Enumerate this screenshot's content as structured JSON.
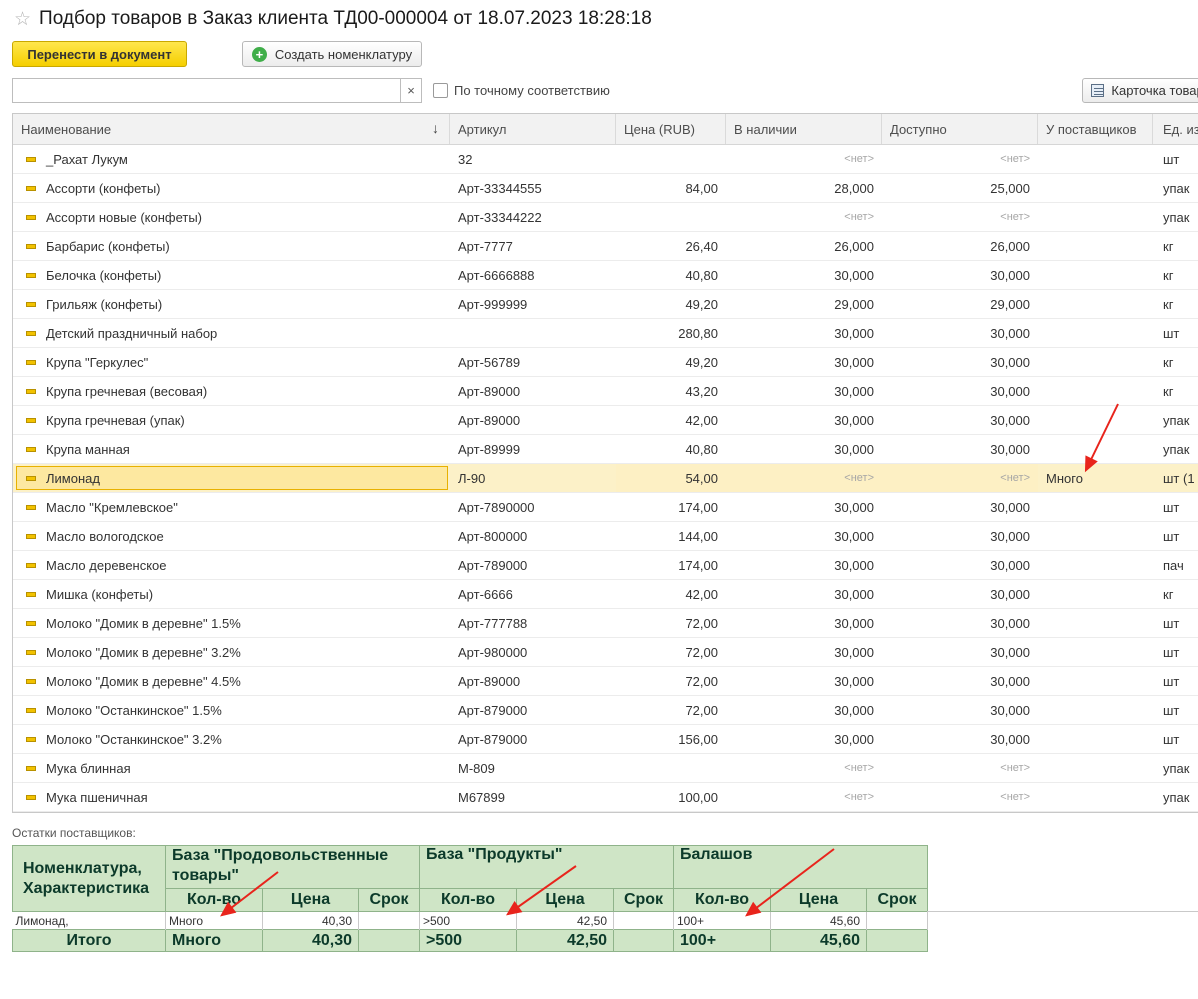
{
  "window": {
    "title": "Подбор товаров в Заказ клиента ТД00-000004 от 18.07.2023 18:28:18"
  },
  "toolbar": {
    "transfer_label": "Перенести в документ",
    "create_label": "Создать номенклатуру",
    "search_value": "",
    "exact_match_label": "По точному соответствию",
    "card_label": "Карточка товара",
    "net_text": "<нет>"
  },
  "grid": {
    "columns": [
      "Наименование",
      "Артикул",
      "Цена (RUB)",
      "В наличии",
      "Доступно",
      "У поставщиков",
      "Ед. изм."
    ],
    "selected_index": 11,
    "rows": [
      {
        "name": "_Рахат Лукум",
        "art": "32",
        "price": "",
        "stock": null,
        "avail": null,
        "supp": "",
        "unit": "шт"
      },
      {
        "name": "Ассорти (конфеты)",
        "art": "Арт-33344555",
        "price": "84,00",
        "stock": "28,000",
        "avail": "25,000",
        "supp": "",
        "unit": "упак"
      },
      {
        "name": "Ассорти новые (конфеты)",
        "art": "Арт-33344222",
        "price": "",
        "stock": null,
        "avail": null,
        "supp": "",
        "unit": "упак"
      },
      {
        "name": "Барбарис (конфеты)",
        "art": "Арт-7777",
        "price": "26,40",
        "stock": "26,000",
        "avail": "26,000",
        "supp": "",
        "unit": "кг"
      },
      {
        "name": "Белочка (конфеты)",
        "art": "Арт-6666888",
        "price": "40,80",
        "stock": "30,000",
        "avail": "30,000",
        "supp": "",
        "unit": "кг"
      },
      {
        "name": "Грильяж (конфеты)",
        "art": "Арт-999999",
        "price": "49,20",
        "stock": "29,000",
        "avail": "29,000",
        "supp": "",
        "unit": "кг"
      },
      {
        "name": "Детский праздничный набор",
        "art": "",
        "price": "280,80",
        "stock": "30,000",
        "avail": "30,000",
        "supp": "",
        "unit": "шт"
      },
      {
        "name": "Крупа \"Геркулес\"",
        "art": "Арт-56789",
        "price": "49,20",
        "stock": "30,000",
        "avail": "30,000",
        "supp": "",
        "unit": "кг"
      },
      {
        "name": "Крупа гречневая (весовая)",
        "art": "Арт-89000",
        "price": "43,20",
        "stock": "30,000",
        "avail": "30,000",
        "supp": "",
        "unit": "кг"
      },
      {
        "name": "Крупа гречневая (упак)",
        "art": "Арт-89000",
        "price": "42,00",
        "stock": "30,000",
        "avail": "30,000",
        "supp": "",
        "unit": "упак"
      },
      {
        "name": "Крупа манная",
        "art": "Арт-89999",
        "price": "40,80",
        "stock": "30,000",
        "avail": "30,000",
        "supp": "",
        "unit": "упак"
      },
      {
        "name": "Лимонад",
        "art": "Л-90",
        "price": "54,00",
        "stock": null,
        "avail": null,
        "supp": "Много",
        "unit": "шт (1"
      },
      {
        "name": "Масло \"Кремлевское\"",
        "art": "Арт-7890000",
        "price": "174,00",
        "stock": "30,000",
        "avail": "30,000",
        "supp": "",
        "unit": "шт"
      },
      {
        "name": "Масло вологодское",
        "art": "Арт-800000",
        "price": "144,00",
        "stock": "30,000",
        "avail": "30,000",
        "supp": "",
        "unit": "шт"
      },
      {
        "name": "Масло деревенское",
        "art": "Арт-789000",
        "price": "174,00",
        "stock": "30,000",
        "avail": "30,000",
        "supp": "",
        "unit": "пач"
      },
      {
        "name": "Мишка (конфеты)",
        "art": "Арт-6666",
        "price": "42,00",
        "stock": "30,000",
        "avail": "30,000",
        "supp": "",
        "unit": "кг"
      },
      {
        "name": "Молоко \"Домик в деревне\" 1.5%",
        "art": "Арт-777788",
        "price": "72,00",
        "stock": "30,000",
        "avail": "30,000",
        "supp": "",
        "unit": "шт"
      },
      {
        "name": "Молоко \"Домик в деревне\" 3.2%",
        "art": "Арт-980000",
        "price": "72,00",
        "stock": "30,000",
        "avail": "30,000",
        "supp": "",
        "unit": "шт"
      },
      {
        "name": "Молоко \"Домик в деревне\" 4.5%",
        "art": "Арт-89000",
        "price": "72,00",
        "stock": "30,000",
        "avail": "30,000",
        "supp": "",
        "unit": "шт"
      },
      {
        "name": "Молоко \"Останкинское\" 1.5%",
        "art": "Арт-879000",
        "price": "72,00",
        "stock": "30,000",
        "avail": "30,000",
        "supp": "",
        "unit": "шт"
      },
      {
        "name": "Молоко \"Останкинское\" 3.2%",
        "art": "Арт-879000",
        "price": "156,00",
        "stock": "30,000",
        "avail": "30,000",
        "supp": "",
        "unit": "шт"
      },
      {
        "name": "Мука блинная",
        "art": "М-809",
        "price": "",
        "stock": null,
        "avail": null,
        "supp": "",
        "unit": "упак"
      },
      {
        "name": "Мука пшеничная",
        "art": "М67899",
        "price": "100,00",
        "stock": null,
        "avail": null,
        "supp": "",
        "unit": "упак"
      }
    ]
  },
  "suppliers": {
    "label": "Остатки поставщиков:",
    "col_item": "Номенклатура, Характеристика",
    "sub_qty": "Кол-во",
    "sub_price": "Цена",
    "sub_term": "Срок",
    "suppliers": [
      {
        "name": "База \"Продовольственные товары\"",
        "qty": "Много",
        "price": "40,30",
        "term": "",
        "total_qty": "Много",
        "total_price": "40,30"
      },
      {
        "name": "База \"Продукты\"",
        "qty": ">500",
        "price": "42,50",
        "term": "",
        "total_qty": ">500",
        "total_price": "42,50"
      },
      {
        "name": "Балашов",
        "qty": "100+",
        "price": "45,60",
        "term": "",
        "total_qty": "100+",
        "total_price": "45,60"
      }
    ],
    "row_item": "Лимонад,",
    "total_label": "Итого"
  },
  "annotation_arrow_color": "#e8241c"
}
